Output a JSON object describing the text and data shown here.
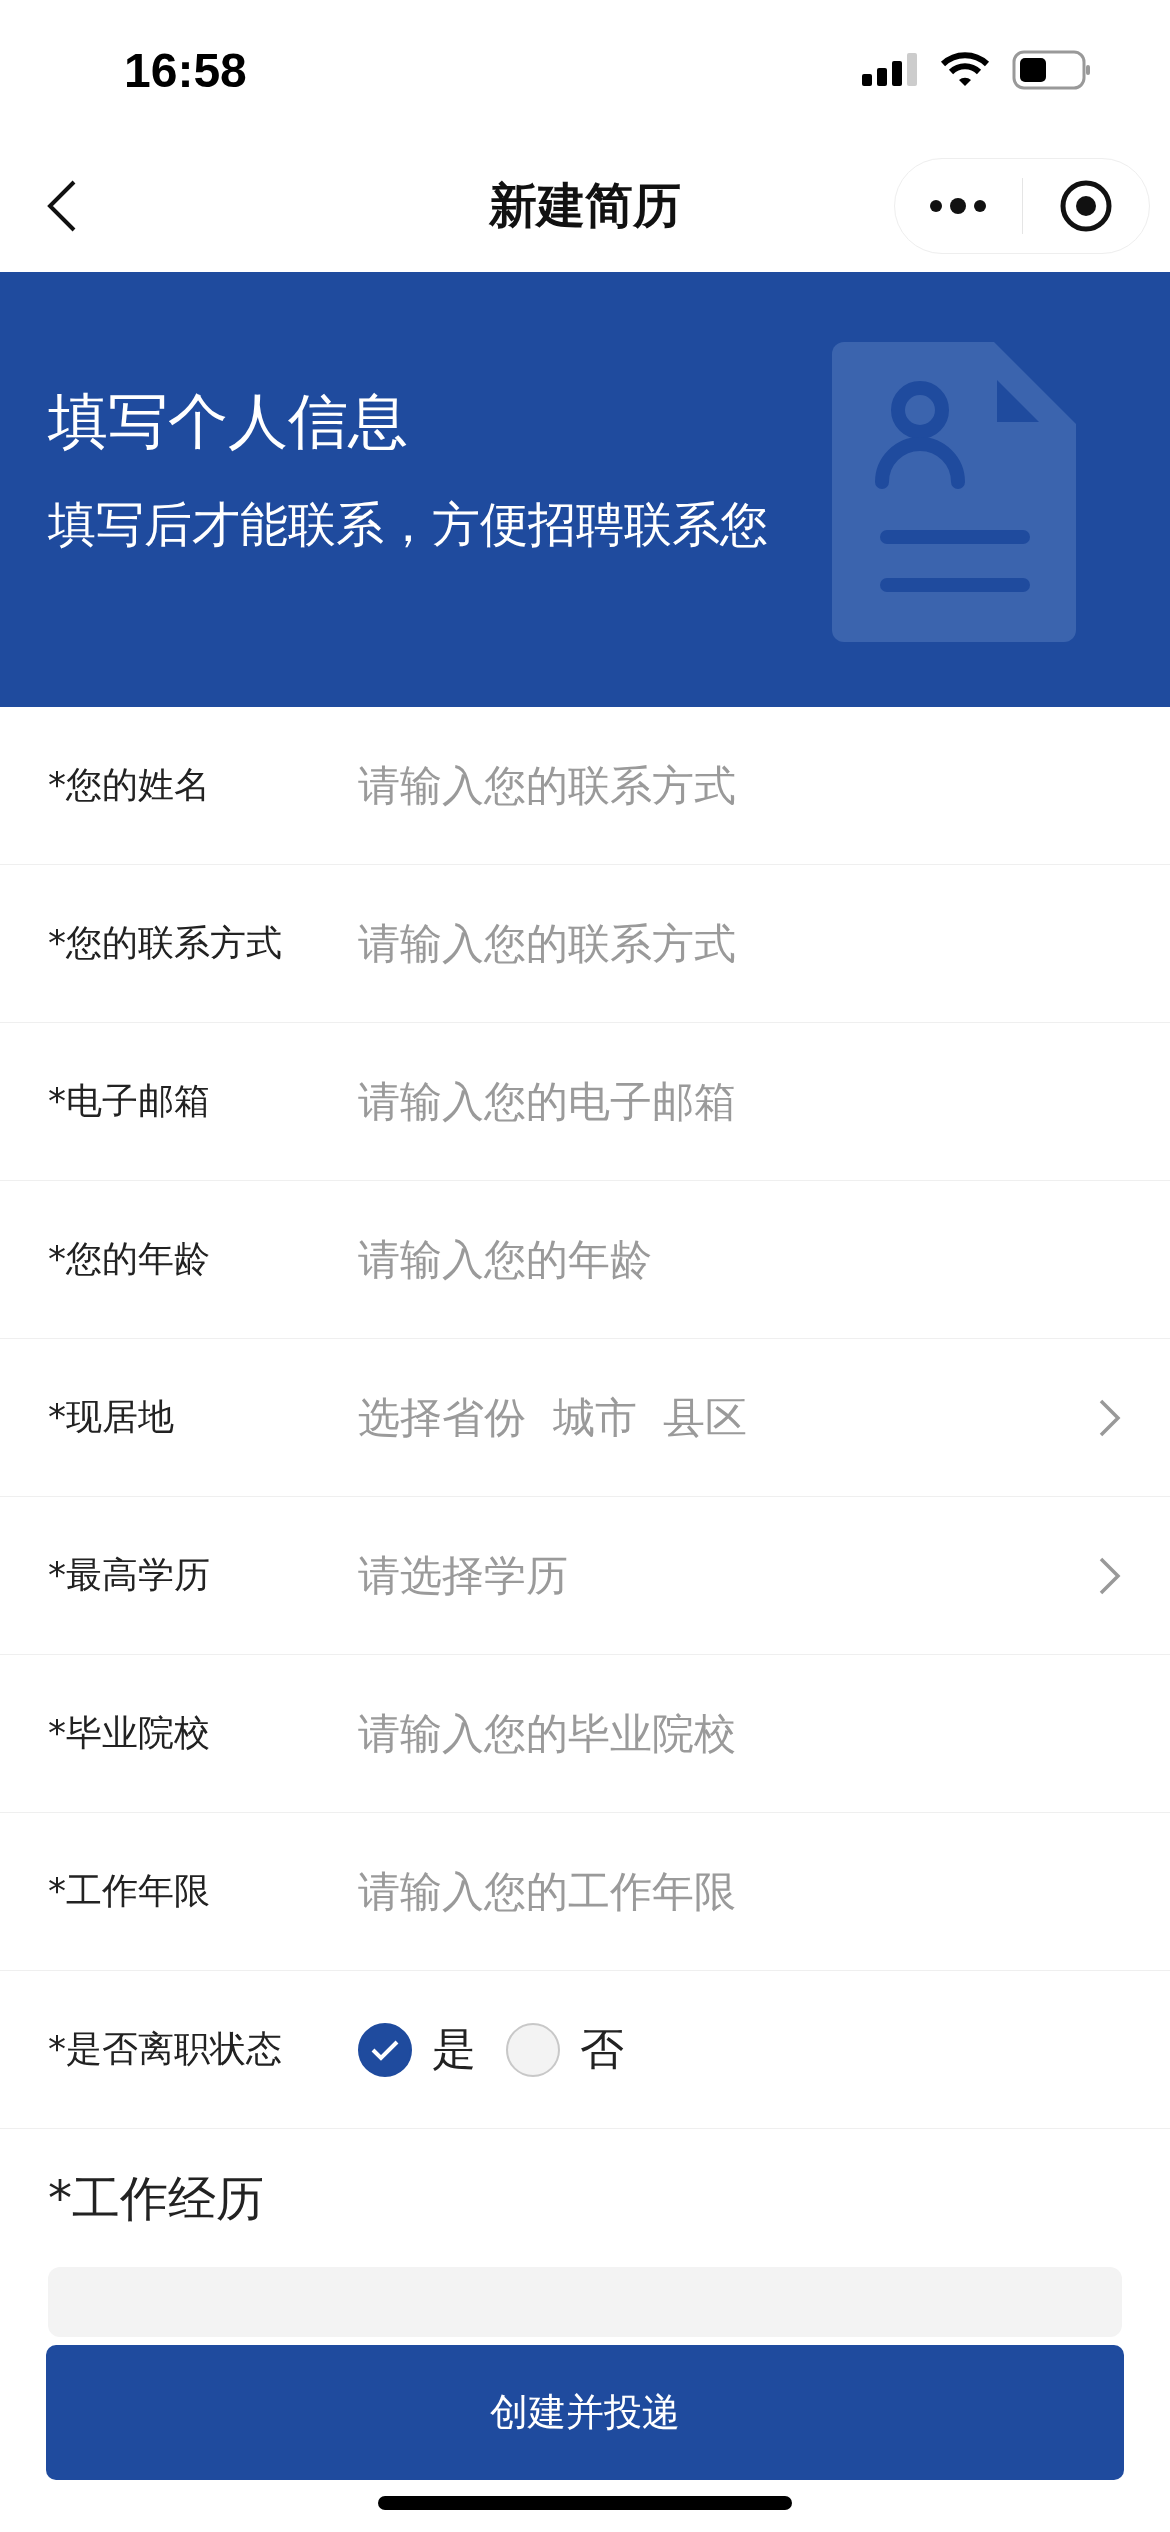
{
  "status_bar": {
    "time": "16:58"
  },
  "nav": {
    "title": "新建简历"
  },
  "banner": {
    "title": "填写个人信息",
    "subtitle": "填写后才能联系，方便招聘联系您"
  },
  "fields": [
    {
      "kind": "input",
      "label": "*您的姓名",
      "placeholder": "请输入您的联系方式"
    },
    {
      "kind": "input",
      "label": "*您的联系方式",
      "placeholder": "请输入您的联系方式"
    },
    {
      "kind": "input",
      "label": "*电子邮箱",
      "placeholder": "请输入您的电子邮箱"
    },
    {
      "kind": "input",
      "label": "*您的年龄",
      "placeholder": "请输入您的年龄"
    },
    {
      "kind": "select",
      "label": "*现居地",
      "placeholder": "选择省份  城市  县区"
    },
    {
      "kind": "select",
      "label": "*最高学历",
      "placeholder": "请选择学历"
    },
    {
      "kind": "input",
      "label": "*毕业院校",
      "placeholder": "请输入您的毕业院校"
    },
    {
      "kind": "input",
      "label": "*工作年限",
      "placeholder": "请输入您的工作年限"
    },
    {
      "kind": "radio",
      "label": "*是否离职状态",
      "options": [
        {
          "label": "是",
          "selected": true
        },
        {
          "label": "否",
          "selected": false
        }
      ]
    }
  ],
  "work_history": {
    "title": "*工作经历"
  },
  "submit_button": "创建并投递"
}
